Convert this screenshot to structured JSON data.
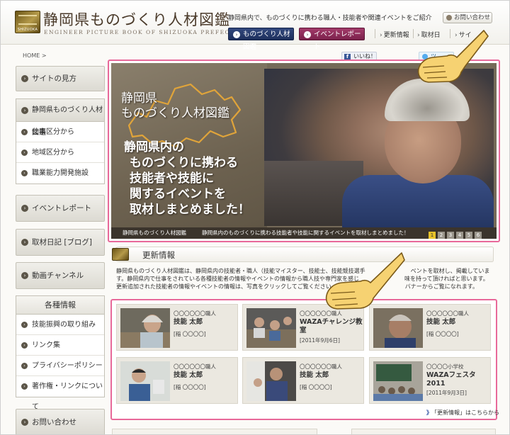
{
  "header": {
    "logo_mark_text": "SHIZUOKA",
    "site_title": "静岡県ものづくり人材図鑑",
    "site_subtitle": "ENGINEER PICTURE BOOK OF SHIZUOKA PREFECTURE",
    "tagline": "静岡県内で、ものづくりに携わる職人・技能者や関連イベントをご紹介",
    "contact_label": "お問い合わせ",
    "nav": {
      "monozukuri": "ものづくり人材図鑑",
      "event": "イベントレポート",
      "links": [
        "更新情報",
        "取材日",
        "サイ"
      ]
    }
  },
  "breadcrumb": "HOME >",
  "social": {
    "like": "いいね！",
    "tweet": "ツ"
  },
  "sidebar": {
    "how_to": "サイトの見方",
    "zukan_group": {
      "title": "静岡県ものづくり人材図鑑",
      "items": [
        "仕事区分から",
        "地域区分から",
        "職業能力開発施設"
      ]
    },
    "event_report": "イベントレポート",
    "blog": "取材日記 [ブログ]",
    "video": "動画チャンネル",
    "info_group": {
      "title": "各種情報",
      "items": [
        "技能振興の取り組み",
        "リンク集",
        "プライバシーポリシー",
        "著作権・リンクについて"
      ]
    },
    "contact": "お問い合わせ"
  },
  "hero": {
    "title_lines": [
      "静岡県",
      "ものづくり人材図鑑"
    ],
    "catch_lines": [
      "静岡県内の",
      "ものづくりに携わる",
      "技能者や技能に",
      "関するイベントを",
      "取材しまとめました！"
    ],
    "bar_title": "静岡県ものづくり人材図鑑",
    "bar_desc": "静岡県内のものづくりに携わる技能者や技能に関するイベントを取材しまとめました！",
    "pages": [
      "1",
      "2",
      "3",
      "4",
      "5",
      "6"
    ],
    "active_page": 1
  },
  "updates": {
    "title": "更新情報",
    "text_lines": [
      "静岡県ものづくり人材図鑑は、静岡県内の技能者・職人（技能マイスター、技能士、技能競技選手　　　　　　　　ベントを取材し、掲載していま",
      "す。静岡県内で仕事をされている各種技能者の情報やイベントの情報から職人技や専門家を感じ　　　　　　　　味を持って頂ければと思います。",
      "更新追加された技能者の情報やイベントの情報は、写真をクリックしてご覧ください。先に　　　　　　　　　　バナーからご覧になれます。"
    ],
    "cards": [
      {
        "category": "〇〇〇〇〇〇職人",
        "name": "技能 太郎",
        "meta": "[稲 〇〇〇〇]"
      },
      {
        "category": "〇〇〇〇〇〇職人",
        "name": "WAZAチャレンジ教室",
        "meta": "[2011年9月6日]"
      },
      {
        "category": "〇〇〇〇〇〇職人",
        "name": "技能 太郎",
        "meta": "[稲 〇〇〇〇]"
      },
      {
        "category": "〇〇〇〇〇〇職人",
        "name": "技能 太郎",
        "meta": "[稲 〇〇〇〇]"
      },
      {
        "category": "〇〇〇〇〇〇職人",
        "name": "技能 太郎",
        "meta": "[稲 〇〇〇〇]"
      },
      {
        "category": "〇〇〇〇小学校",
        "name": "WAZAフェスタ2011",
        "meta": "[2011年9月3日]"
      }
    ],
    "more_prefix": "》",
    "more_link": "「更新情報」はこちらから"
  },
  "colors": {
    "highlight": "#e8699a",
    "nav_blue": "#26396a",
    "nav_red": "#8e2b58",
    "pager_active": "#e8c32a"
  }
}
